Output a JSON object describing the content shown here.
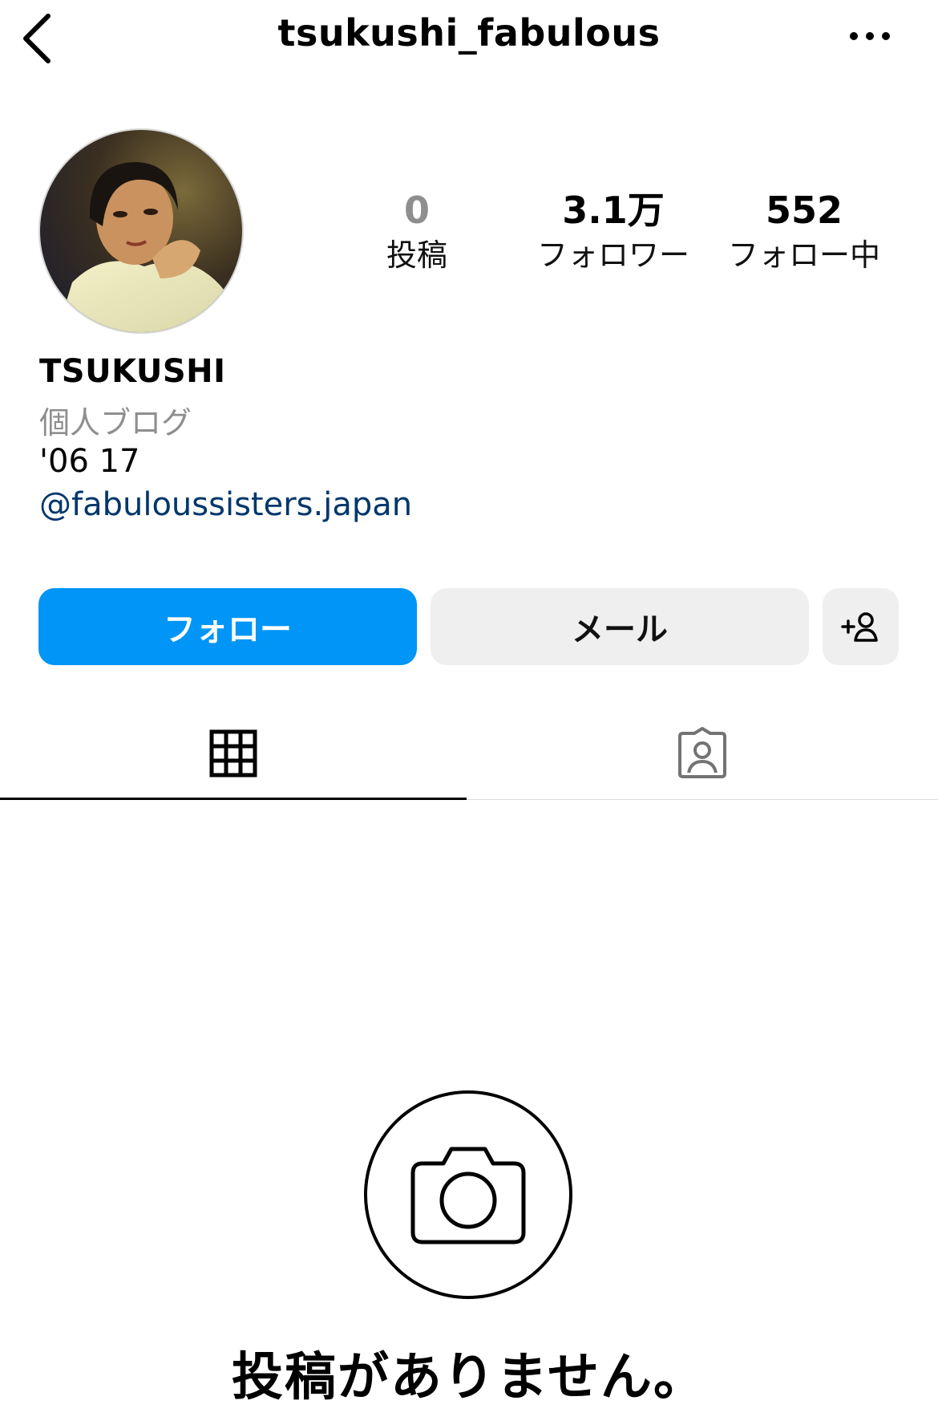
{
  "header": {
    "username": "tsukushi_fabulous",
    "back_icon": "chevron-left-icon",
    "more_icon": "ellipsis-icon"
  },
  "profile": {
    "display_name": "TSUKUSHI",
    "category": "個人ブログ",
    "bio": "'06 17",
    "link": "@fabuloussisters.japan"
  },
  "stats": {
    "posts": {
      "value": "0",
      "label": "投稿"
    },
    "followers": {
      "value": "3.1万",
      "label": "フォロワー"
    },
    "following": {
      "value": "552",
      "label": "フォロー中"
    }
  },
  "actions": {
    "follow_label": "フォロー",
    "mail_label": "メール",
    "add_icon": "add-person-icon"
  },
  "tabs": [
    {
      "icon": "grid-icon",
      "active": true
    },
    {
      "icon": "tagged-person-icon",
      "active": false
    }
  ],
  "empty_state": {
    "icon": "camera-icon",
    "message": "投稿がありません。"
  },
  "colors": {
    "follow_button": "#0095f6",
    "secondary_button": "#efefef",
    "link": "#00376b",
    "muted_text": "#8e8e8e"
  }
}
